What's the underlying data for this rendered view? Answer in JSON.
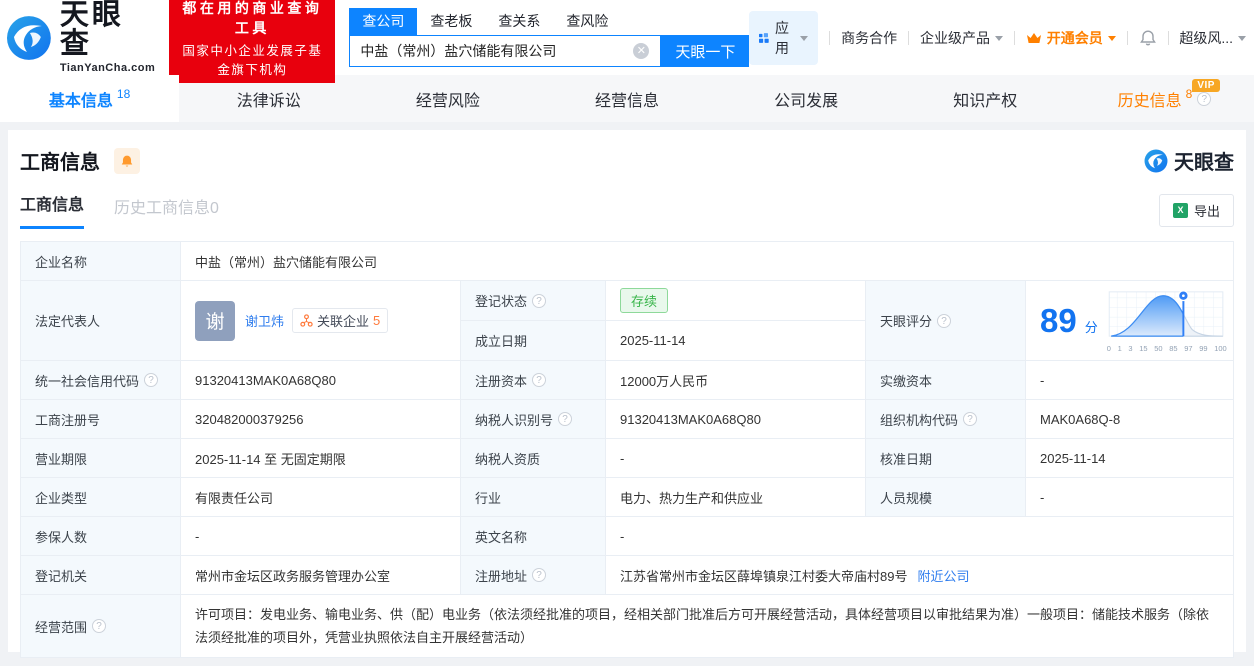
{
  "brand": {
    "name": "天眼查",
    "domain": "TianYanCha.com",
    "slogan_line1": "都在用的商业查询工具",
    "slogan_line2": "国家中小企业发展子基金旗下机构"
  },
  "search": {
    "tabs": [
      "查公司",
      "查老板",
      "查关系",
      "查风险"
    ],
    "value": "中盐（常州）盐穴储能有限公司",
    "button_label": "天眼一下"
  },
  "topmenu": {
    "apps": "应用",
    "cooperation": "商务合作",
    "enterprise_products": "企业级产品",
    "join_vip": "开通会员",
    "super_risk": "超级风...",
    "vip_badge": "VIP"
  },
  "nav": {
    "tabs": [
      {
        "label": "基本信息",
        "count": "18"
      },
      {
        "label": "法律诉讼"
      },
      {
        "label": "经营风险"
      },
      {
        "label": "经营信息"
      },
      {
        "label": "公司发展"
      },
      {
        "label": "知识产权"
      },
      {
        "label": "历史信息",
        "count": "8"
      }
    ]
  },
  "section": {
    "title": "工商信息",
    "watermark": "天眼查",
    "export_label": "导出",
    "subtab_active": "工商信息",
    "subtab_history": "历史工商信息0"
  },
  "info": {
    "company_name_label": "企业名称",
    "company_name": "中盐（常州）盐穴储能有限公司",
    "legal_rep_label": "法定代表人",
    "legal_rep_avatar": "谢",
    "legal_rep_name": "谢卫炜",
    "related_companies_label": "关联企业",
    "related_companies_count": "5",
    "reg_status_label": "登记状态",
    "reg_status": "存续",
    "establish_date_label": "成立日期",
    "establish_date": "2025-11-14",
    "score_label": "天眼评分",
    "score_value": "89",
    "score_unit": "分",
    "credit_code_label": "统一社会信用代码",
    "credit_code": "91320413MAK0A68Q80",
    "reg_capital_label": "注册资本",
    "reg_capital": "12000万人民币",
    "paid_capital_label": "实缴资本",
    "paid_capital": "-",
    "reg_number_label": "工商注册号",
    "reg_number": "320482000379256",
    "taxpayer_id_label": "纳税人识别号",
    "taxpayer_id": "91320413MAK0A68Q80",
    "org_code_label": "组织机构代码",
    "org_code": "MAK0A68Q-8",
    "business_term_label": "营业期限",
    "business_term": "2025-11-14 至 无固定期限",
    "taxpayer_quality_label": "纳税人资质",
    "taxpayer_quality": "-",
    "approve_date_label": "核准日期",
    "approve_date": "2025-11-14",
    "company_type_label": "企业类型",
    "company_type": "有限责任公司",
    "industry_label": "行业",
    "industry": "电力、热力生产和供应业",
    "staff_size_label": "人员规模",
    "staff_size": "-",
    "insured_label": "参保人数",
    "insured": "-",
    "english_name_label": "英文名称",
    "english_name": "-",
    "reg_authority_label": "登记机关",
    "reg_authority": "常州市金坛区政务服务管理办公室",
    "address_label": "注册地址",
    "address": "江苏省常州市金坛区薛埠镇泉江村委大帝庙村89号",
    "nearby_label": "附近公司",
    "business_scope_label": "经营范围",
    "business_scope": "许可项目：发电业务、输电业务、供（配）电业务（依法须经批准的项目，经相关部门批准后方可开展经营活动，具体经营项目以审批结果为准）一般项目：储能技术服务（除依法须经批准的项目外，凭营业执照依法自主开展经营活动）"
  },
  "chart_data": {
    "type": "area",
    "title": "天眼评分分布曲线",
    "x_ticks": [
      "0",
      "1",
      "3",
      "15",
      "50",
      "85",
      "97",
      "99",
      "100"
    ],
    "marker_value": 89,
    "score": 89,
    "legend_position": "none",
    "grid": true
  },
  "colors": {
    "primary_blue": "#0d84ff",
    "brand_red": "#e8000d",
    "vip_orange": "#ff8000",
    "status_green": "#39b54a",
    "label_bg": "#f4f9fd",
    "score_blue": "#1273f0"
  }
}
